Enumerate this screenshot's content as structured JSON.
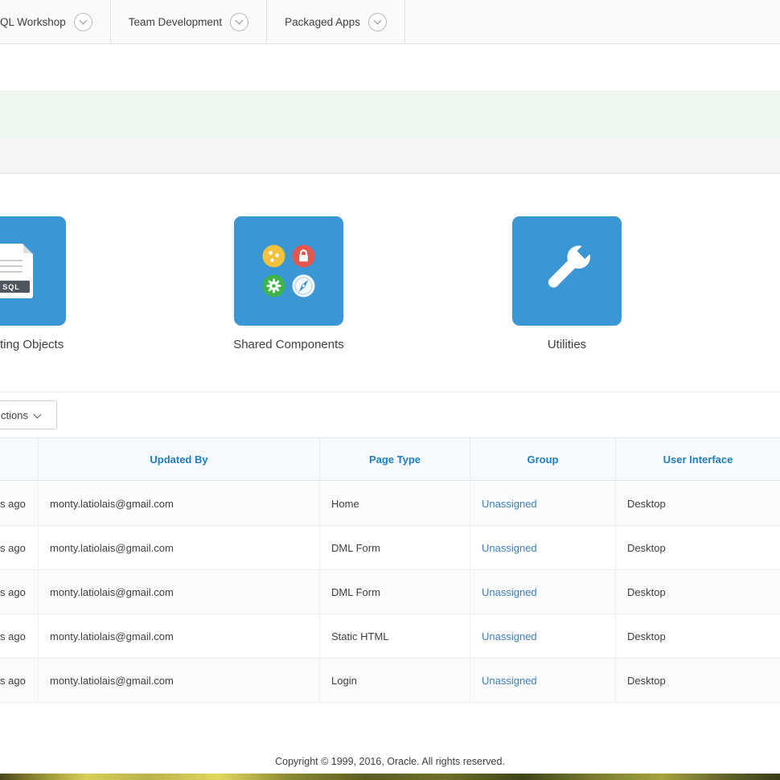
{
  "nav": {
    "tabs": [
      {
        "label": "QL Workshop"
      },
      {
        "label": "Team Development"
      },
      {
        "label": "Packaged Apps"
      }
    ]
  },
  "tiles": [
    {
      "label": "ting Objects",
      "badge": "SQL",
      "icon": "sql-document-icon"
    },
    {
      "label": "Shared Components",
      "icon": "shared-components-icon"
    },
    {
      "label": "Utilities",
      "icon": "wrench-icon"
    }
  ],
  "report": {
    "actions_button": "ctions",
    "columns": [
      "Updated By",
      "Page Type",
      "Group",
      "User Interface"
    ],
    "rows": [
      {
        "updated": "s ago",
        "updated_by": "monty.latiolais@gmail.com",
        "page_type": "Home",
        "group": "Unassigned",
        "user_interface": "Desktop"
      },
      {
        "updated": "s ago",
        "updated_by": "monty.latiolais@gmail.com",
        "page_type": "DML Form",
        "group": "Unassigned",
        "user_interface": "Desktop"
      },
      {
        "updated": "s ago",
        "updated_by": "monty.latiolais@gmail.com",
        "page_type": "DML Form",
        "group": "Unassigned",
        "user_interface": "Desktop"
      },
      {
        "updated": "s ago",
        "updated_by": "monty.latiolais@gmail.com",
        "page_type": "Static HTML",
        "group": "Unassigned",
        "user_interface": "Desktop"
      },
      {
        "updated": "s ago",
        "updated_by": "monty.latiolais@gmail.com",
        "page_type": "Login",
        "group": "Unassigned",
        "user_interface": "Desktop"
      }
    ]
  },
  "footer": {
    "copyright": "Copyright © 1999, 2016, Oracle. All rights reserved."
  },
  "colors": {
    "tile_blue": "#3b97d3",
    "header_text": "#1f7dc2",
    "link_blue": "#3d7fc1",
    "success_band": "#ecf8ef",
    "gray_band": "#f5f5f5"
  },
  "icons": {
    "nav_tab_menu": "chevron-down-circle",
    "actions_menu": "chevron-down",
    "tile_supporting_objects": "sql-document",
    "tile_shared_components": "cookie, lock, gear, compass circles",
    "tile_utilities": "wrench"
  }
}
